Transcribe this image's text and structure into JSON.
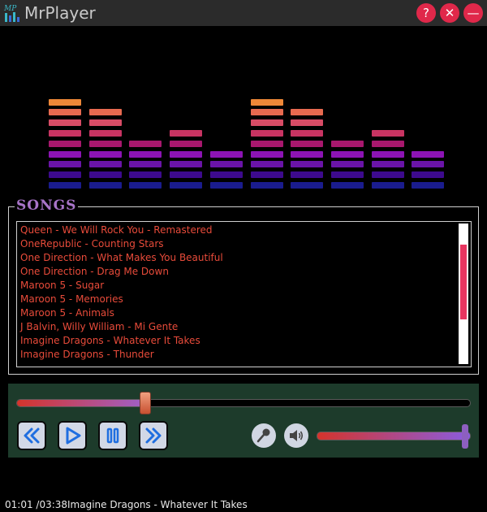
{
  "app": {
    "title": "MrPlayer",
    "logo_text": "MP",
    "help_label": "?",
    "close_label": "✕",
    "minimize_label": "—"
  },
  "equalizer": {
    "levels": [
      9,
      8,
      5,
      6,
      4,
      9,
      8,
      5,
      6,
      4
    ],
    "colors": [
      "#1a1c8e",
      "#3d0a8e",
      "#6a14a8",
      "#8c14b4",
      "#a8186e",
      "#c83462",
      "#d84c66",
      "#e86a50",
      "#ef8838",
      "#f4a020"
    ]
  },
  "songs": {
    "legend": "SONGS",
    "items": [
      "Queen - We Will Rock You - Remastered",
      "OneRepublic - Counting Stars",
      "One Direction - What Makes You Beautiful",
      "One Direction - Drag Me Down",
      "Maroon 5 - Sugar",
      "Maroon 5 - Memories",
      "Maroon 5 - Animals",
      "J Balvin, Willy William - Mi Gente",
      "Imagine Dragons - Whatever It Takes",
      "Imagine Dragons - Thunder"
    ]
  },
  "controls": {
    "seek_progress": 0.284,
    "volume": 1.0,
    "icons": {
      "rewind": "rewind-icon",
      "play": "play-icon",
      "pause": "pause-icon",
      "forward": "fast-forward-icon",
      "mic": "microphone-icon",
      "speaker": "speaker-icon"
    },
    "accent": "#e0284a",
    "panel_color": "#1d3b2b"
  },
  "status": {
    "time": "01:01 /03:38",
    "now_playing": "Imagine Dragons - Whatever It Takes"
  }
}
